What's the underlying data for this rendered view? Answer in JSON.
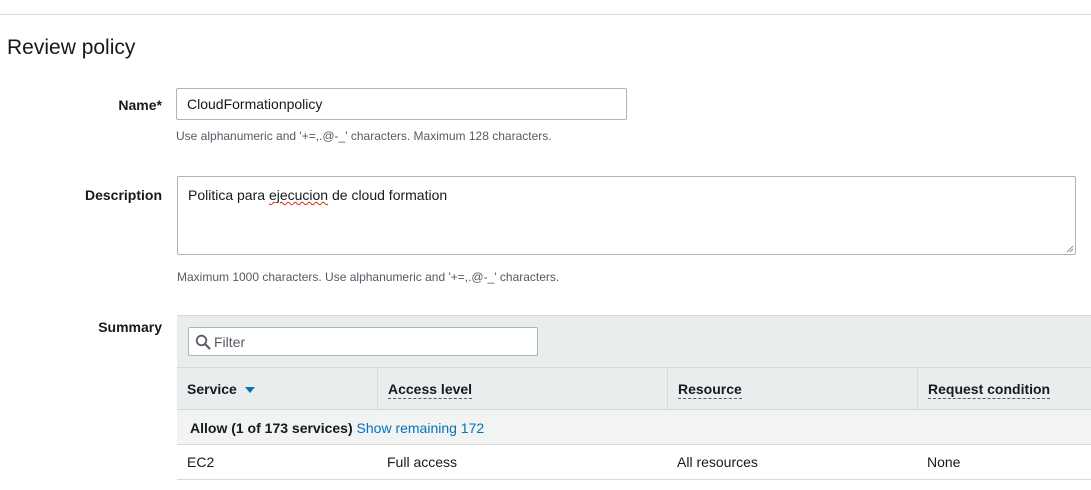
{
  "page": {
    "title": "Review policy"
  },
  "name_field": {
    "label": "Name*",
    "value": "CloudFormationpolicy",
    "hint": "Use alphanumeric and '+=,.@-_' characters. Maximum 128 characters."
  },
  "description_field": {
    "label": "Description",
    "value_before": "Politica para ",
    "value_misspelled": "ejecucion",
    "value_after": " de cloud formation",
    "hint": "Maximum 1000 characters. Use alphanumeric and '+=,.@-_' characters."
  },
  "summary": {
    "label": "Summary",
    "filter_placeholder": "Filter",
    "columns": {
      "service": "Service",
      "access_level": "Access level",
      "resource": "Resource",
      "request_condition": "Request condition"
    },
    "group": {
      "label": "Allow (1 of 173 services)",
      "link": "Show remaining 172"
    },
    "rows": [
      {
        "service": "EC2",
        "access_level": "Full access",
        "resource": "All resources",
        "request_condition": "None"
      }
    ]
  },
  "colors": {
    "link": "#0073bb",
    "panel_bg": "#eaeded",
    "border": "#aab7b8",
    "text": "#16191f"
  },
  "icons": {
    "filter": "search-icon",
    "sort": "caret-down-icon",
    "resize": "resize-grip-icon"
  }
}
